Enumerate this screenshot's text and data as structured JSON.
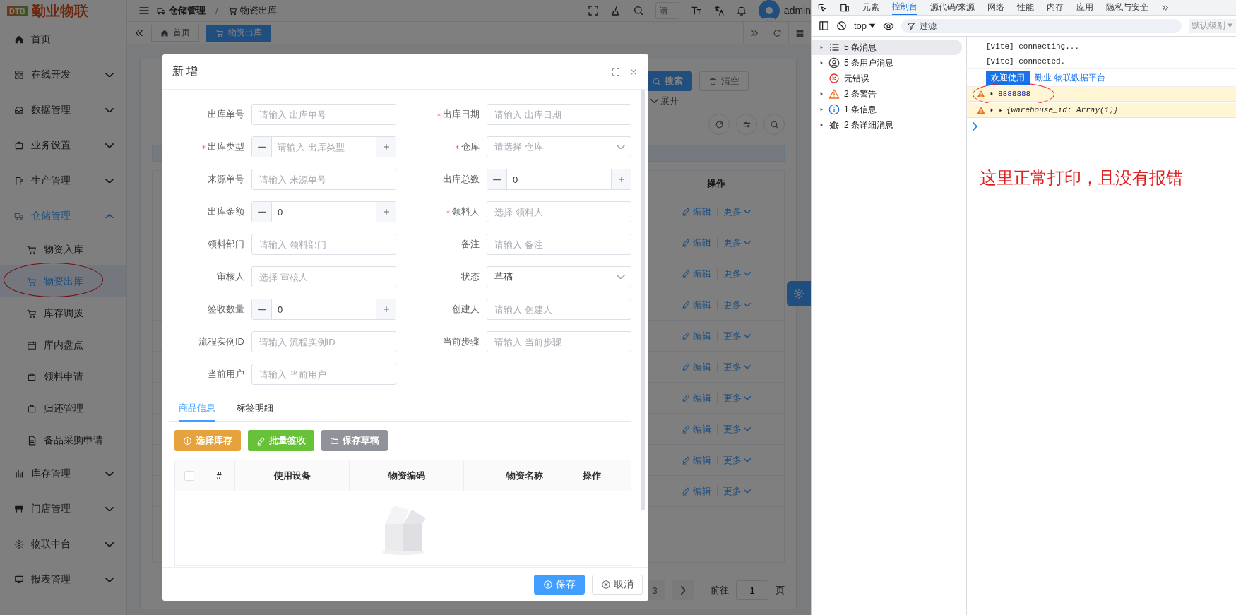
{
  "sidebar": {
    "logo_badge": "DTB",
    "logo_text": "勤业物联",
    "items": [
      {
        "label": "首页",
        "kind": "link",
        "selected": false
      },
      {
        "label": "在线开发",
        "kind": "group",
        "expanded": false,
        "selected": false
      },
      {
        "label": "数据管理",
        "kind": "group",
        "expanded": false,
        "selected": false
      },
      {
        "label": "业务设置",
        "kind": "group",
        "expanded": false,
        "selected": false
      },
      {
        "label": "生产管理",
        "kind": "group",
        "expanded": false,
        "selected": false
      },
      {
        "label": "仓储管理",
        "kind": "group",
        "expanded": true,
        "selected": true,
        "children": [
          {
            "label": "物资入库",
            "selected": false,
            "circled": false
          },
          {
            "label": "物资出库",
            "selected": true,
            "circled": true
          },
          {
            "label": "库存调拨",
            "selected": false,
            "circled": false
          },
          {
            "label": "库内盘点",
            "selected": false,
            "circled": false
          },
          {
            "label": "领料申请",
            "selected": false,
            "circled": false
          },
          {
            "label": "归还管理",
            "selected": false,
            "circled": false
          },
          {
            "label": "备品采购申请",
            "selected": false,
            "circled": false
          }
        ]
      },
      {
        "label": "库存管理",
        "kind": "group",
        "expanded": false,
        "selected": false
      },
      {
        "label": "门店管理",
        "kind": "group",
        "expanded": false,
        "selected": false
      },
      {
        "label": "物联中台",
        "kind": "group",
        "expanded": false,
        "selected": false
      },
      {
        "label": "报表管理",
        "kind": "group",
        "expanded": false,
        "selected": false
      }
    ]
  },
  "header": {
    "breadcrumb": [
      {
        "label": "仓储管理"
      },
      {
        "label": "物资出库"
      }
    ],
    "separator": "/",
    "search_placeholder": "请",
    "user": "admin"
  },
  "tabs": [
    {
      "label": "首页",
      "selected": false
    },
    {
      "label": "物资出库",
      "selected": true
    }
  ],
  "search_panel": {
    "search_button": "搜索",
    "clear_button": "清空",
    "expand_toggle": "展开"
  },
  "table": {
    "columns": [
      "操作"
    ],
    "rows": [
      {
        "edit": "编辑",
        "more": "更多"
      },
      {
        "edit": "编辑",
        "more": "更多"
      },
      {
        "edit": "编辑",
        "more": "更多"
      },
      {
        "edit": "编辑",
        "more": "更多"
      },
      {
        "edit": "编辑",
        "more": "更多"
      },
      {
        "edit": "编辑",
        "more": "更多"
      },
      {
        "edit": "编辑",
        "more": "更多"
      },
      {
        "edit": "编辑",
        "more": "更多"
      },
      {
        "edit": "编辑",
        "more": "更多"
      },
      {
        "edit": "编辑",
        "more": "更多"
      }
    ]
  },
  "pagination": {
    "current_page": "3",
    "goto_label": "前往",
    "goto_value": "1",
    "page_suffix": "页"
  },
  "dialog": {
    "title": "新 增",
    "fields": [
      {
        "label": "出库单号",
        "kind": "text",
        "required": false,
        "placeholder": "请输入 出库单号"
      },
      {
        "label": "出库日期",
        "kind": "text",
        "required": true,
        "placeholder": "请输入 出库日期"
      },
      {
        "label": "出库类型",
        "kind": "number",
        "required": true,
        "placeholder": "请输入 出库类型"
      },
      {
        "label": "仓库",
        "kind": "select",
        "required": true,
        "placeholder": "请选择 仓库"
      },
      {
        "label": "来源单号",
        "kind": "text",
        "required": false,
        "placeholder": "请输入 来源单号"
      },
      {
        "label": "出库总数",
        "kind": "number",
        "required": false,
        "value": "0"
      },
      {
        "label": "出库金额",
        "kind": "number",
        "required": false,
        "value": "0"
      },
      {
        "label": "领料人",
        "kind": "text",
        "required": true,
        "placeholder": "选择 领料人"
      },
      {
        "label": "领料部门",
        "kind": "text",
        "required": false,
        "placeholder": "请输入 领料部门"
      },
      {
        "label": "备注",
        "kind": "text",
        "required": false,
        "placeholder": "请输入 备注"
      },
      {
        "label": "审核人",
        "kind": "text",
        "required": false,
        "placeholder": "选择 审核人"
      },
      {
        "label": "状态",
        "kind": "select",
        "required": false,
        "value": "草稿"
      },
      {
        "label": "签收数量",
        "kind": "number",
        "required": false,
        "value": "0"
      },
      {
        "label": "创建人",
        "kind": "text",
        "required": false,
        "placeholder": "请输入 创建人"
      },
      {
        "label": "流程实例ID",
        "kind": "text",
        "required": false,
        "placeholder": "请输入 流程实例ID"
      },
      {
        "label": "当前步骤",
        "kind": "text",
        "required": false,
        "placeholder": "请输入 当前步骤"
      },
      {
        "label": "当前用户",
        "kind": "text",
        "required": false,
        "placeholder": "请输入 当前用户"
      }
    ],
    "tabs": [
      {
        "label": "商品信息",
        "selected": true
      },
      {
        "label": "标签明细",
        "selected": false
      }
    ],
    "toolbar_buttons": [
      {
        "label": "选择库存",
        "kind": "warning"
      },
      {
        "label": "批量签收",
        "kind": "success"
      },
      {
        "label": "保存草稿",
        "kind": "info"
      }
    ],
    "table": {
      "select_all_checked": false,
      "columns": [
        "#",
        "使用设备",
        "物资编码",
        "物资名称",
        "操作"
      ]
    },
    "footer_buttons": [
      {
        "label": "保存",
        "kind": "primary"
      },
      {
        "label": "取消",
        "kind": "default"
      }
    ]
  },
  "devtools": {
    "tabs": [
      {
        "label": "元素",
        "selected": false
      },
      {
        "label": "控制台",
        "selected": true
      },
      {
        "label": "源代码/来源",
        "selected": false
      },
      {
        "label": "网络",
        "selected": false
      },
      {
        "label": "性能",
        "selected": false
      },
      {
        "label": "内存",
        "selected": false
      },
      {
        "label": "应用",
        "selected": false
      },
      {
        "label": "隐私与安全",
        "selected": false
      }
    ],
    "context": "top",
    "filter_placeholder": "过滤",
    "level_select": "默认级别",
    "sidebar": [
      {
        "label": "5 条消息",
        "kind": "messages",
        "selected": true,
        "expandable": true
      },
      {
        "label": "5 条用户消息",
        "kind": "user",
        "selected": false,
        "expandable": true
      },
      {
        "label": "无错误",
        "kind": "errors",
        "selected": false,
        "expandable": false
      },
      {
        "label": "2 条警告",
        "kind": "warnings",
        "selected": false,
        "expandable": true
      },
      {
        "label": "1 条信息",
        "kind": "info",
        "selected": false,
        "expandable": true
      },
      {
        "label": "2 条详细消息",
        "kind": "verbose",
        "selected": false,
        "expandable": true
      }
    ],
    "console": [
      {
        "kind": "log",
        "text": "[vite] connecting...",
        "circled": false
      },
      {
        "kind": "log",
        "text": "[vite] connected.",
        "circled": false
      },
      {
        "kind": "badges",
        "parts": [
          "欢迎使用",
          "勤业-物联数据平台"
        ],
        "circled": false
      },
      {
        "kind": "warning",
        "text": "8888888",
        "circled": true
      },
      {
        "kind": "warning_object",
        "text": "{warehouse_id: Array(1)}",
        "circled": false
      }
    ],
    "annotation": "这里正常打印，且没有报错"
  }
}
